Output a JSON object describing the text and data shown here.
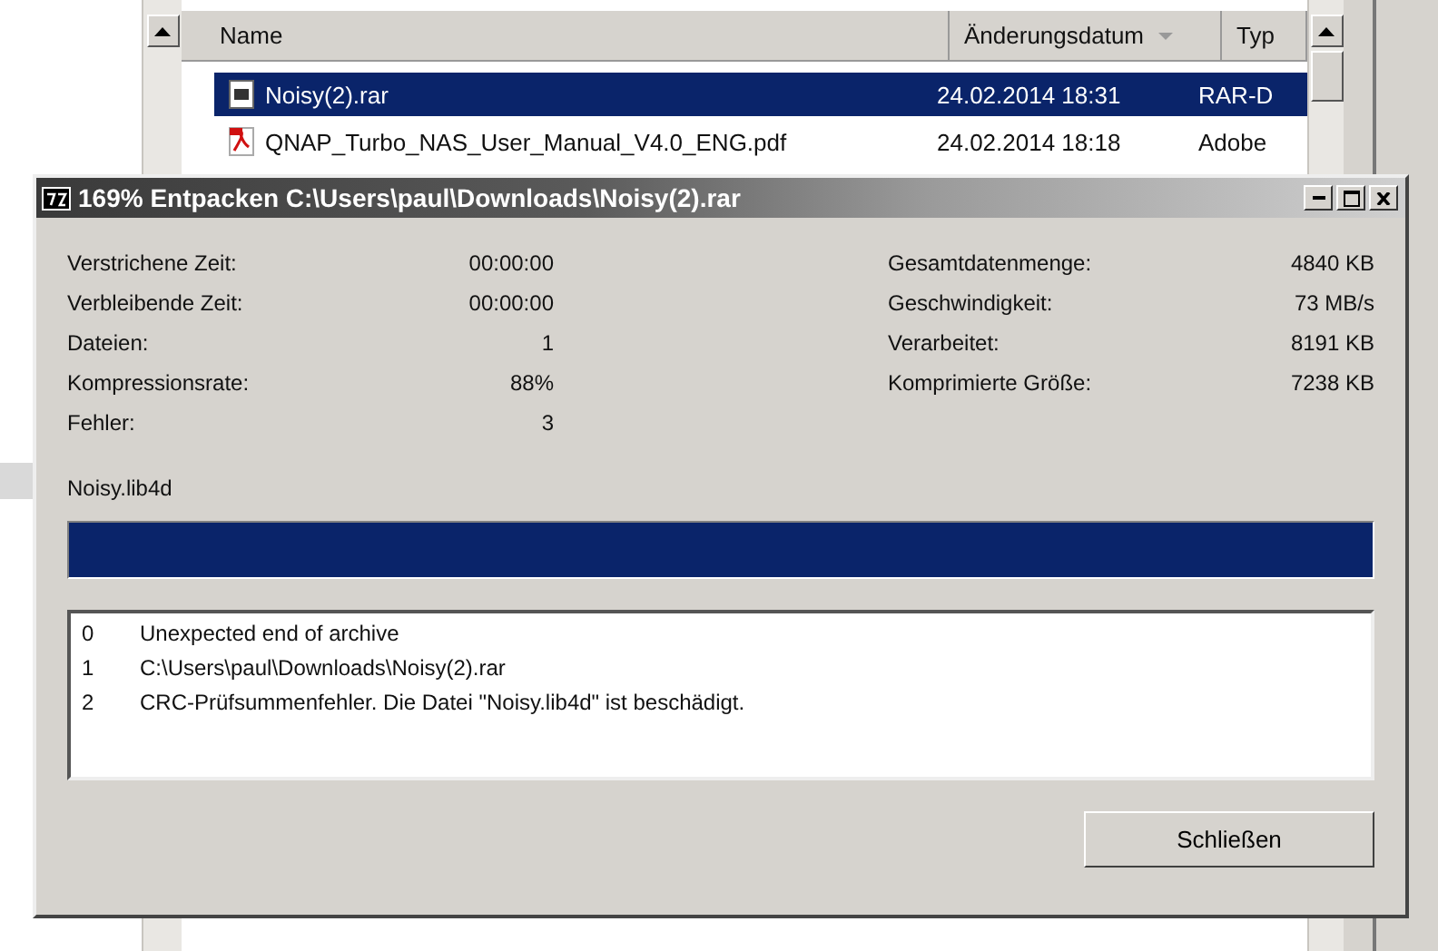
{
  "explorer": {
    "columns": [
      {
        "label": "Name",
        "sorted": false
      },
      {
        "label": "Änderungsdatum",
        "sorted": true
      },
      {
        "label": "Typ",
        "sorted": false
      }
    ],
    "files": [
      {
        "kind": "archive",
        "name": "Noisy(2).rar",
        "date": "24.02.2014 18:31",
        "type": "RAR-D",
        "selected": true
      },
      {
        "kind": "pdf",
        "name": "QNAP_Turbo_NAS_User_Manual_V4.0_ENG.pdf",
        "date": "24.02.2014 18:18",
        "type": "Adobe",
        "selected": false
      }
    ]
  },
  "dialog": {
    "title": "169% Entpacken C:\\Users\\paul\\Downloads\\Noisy(2).rar",
    "stats_left": [
      {
        "label": "Verstrichene Zeit:",
        "value": "00:00:00"
      },
      {
        "label": "Verbleibende Zeit:",
        "value": "00:00:00"
      },
      {
        "label": "Dateien:",
        "value": "1"
      },
      {
        "label": "Kompressionsrate:",
        "value": "88%"
      },
      {
        "label": "Fehler:",
        "value": "3"
      }
    ],
    "stats_right": [
      {
        "label": "Gesamtdatenmenge:",
        "value": "4840 KB"
      },
      {
        "label": "Geschwindigkeit:",
        "value": "73 MB/s"
      },
      {
        "label": "Verarbeitet:",
        "value": "8191 KB"
      },
      {
        "label": "Komprimierte Größe:",
        "value": "7238 KB"
      }
    ],
    "current_file": "Noisy.lib4d",
    "progress": {
      "level": 1
    },
    "log": [
      {
        "index": "0",
        "message": "Unexpected end of archive"
      },
      {
        "index": "1",
        "message": "C:\\Users\\paul\\Downloads\\Noisy(2).rar"
      },
      {
        "index": "2",
        "message": "CRC-Prüfsummenfehler. Die Datei \"Noisy.lib4d\" ist beschädigt."
      }
    ],
    "buttons": [
      "Schließen"
    ]
  }
}
